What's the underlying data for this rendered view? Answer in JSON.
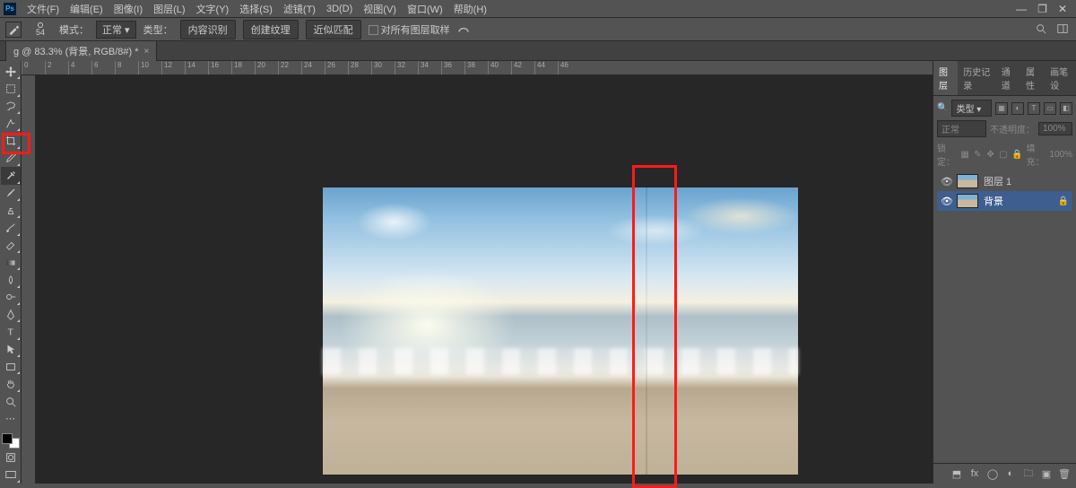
{
  "menubar": {
    "items": [
      "文件(F)",
      "编辑(E)",
      "图像(I)",
      "图层(L)",
      "文字(Y)",
      "选择(S)",
      "滤镜(T)",
      "3D(D)",
      "视图(V)",
      "窗口(W)",
      "帮助(H)"
    ]
  },
  "optbar": {
    "brush_size": "54",
    "mode_label": "模式：",
    "mode_value": "正常",
    "type_label": "类型：",
    "btn_content_aware": "内容识别",
    "btn_create_texture": "创建纹理",
    "btn_proximity": "近似匹配",
    "chk_sample_all": "对所有图层取样"
  },
  "doc": {
    "tab_title": "g @ 83.3% (背景, RGB/8#) *"
  },
  "ruler": {
    "ticks": [
      "0",
      "2",
      "4",
      "6",
      "8",
      "10",
      "12",
      "14",
      "16",
      "18",
      "20",
      "22",
      "24",
      "26",
      "28",
      "30",
      "32",
      "34",
      "36",
      "38",
      "40",
      "42",
      "44",
      "46"
    ]
  },
  "panels": {
    "tabs": [
      "图层",
      "历史记录",
      "通道",
      "属性",
      "画笔设"
    ],
    "filter_label": "类型",
    "blend_label": "正常",
    "opacity_label": "不透明度：",
    "opacity_value": "100%",
    "lock_label": "锁定：",
    "fill_label": "填充：",
    "fill_value": "100%",
    "layers": [
      {
        "name": "图层 1",
        "visible": true,
        "locked": false
      },
      {
        "name": "背景",
        "visible": true,
        "locked": true
      }
    ]
  }
}
